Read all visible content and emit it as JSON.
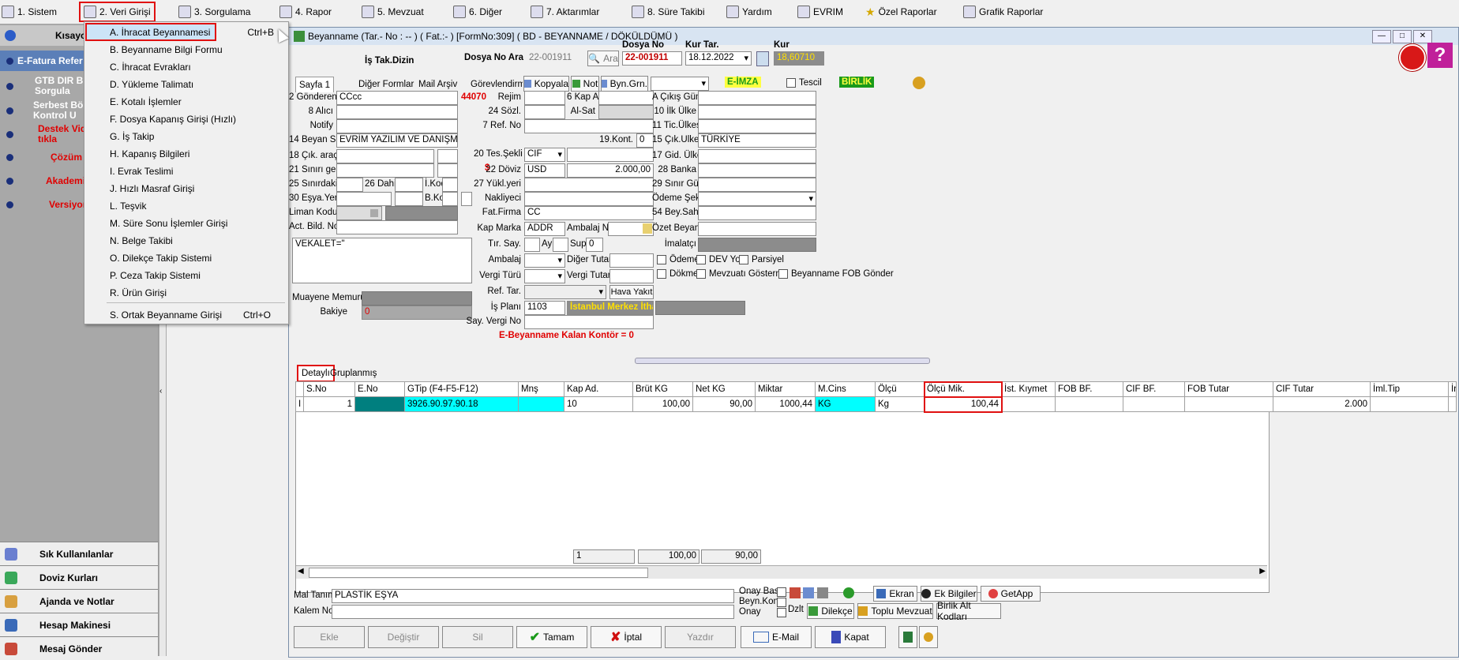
{
  "menubar": {
    "items": [
      {
        "label": "1.  Sistem"
      },
      {
        "label": "2.  Veri Girişi"
      },
      {
        "label": "3.  Sorgulama"
      },
      {
        "label": "4.  Rapor"
      },
      {
        "label": "5.  Mevzuat"
      },
      {
        "label": "6.  Diğer"
      },
      {
        "label": "7.  Aktarımlar"
      },
      {
        "label": "8. Süre Takibi"
      },
      {
        "label": "Yardım"
      },
      {
        "label": "EVRIM"
      },
      {
        "label": "Özel Raporlar"
      },
      {
        "label": "Grafik Raporlar"
      }
    ]
  },
  "sidebar": {
    "header": "Kısayo",
    "rows": [
      {
        "label": "E-Fatura Refer",
        "color": "#ffffff"
      },
      {
        "label": "GTB DIR B Sorgula",
        "color": "#ffffff"
      },
      {
        "label": "Serbest Böl Kontrol U",
        "color": "#ffffff"
      },
      {
        "label": "Destek Vid tıkla",
        "color": "#e00000"
      },
      {
        "label": "Çözüm",
        "color": "#e00000"
      },
      {
        "label": "Akademi",
        "color": "#e00000"
      },
      {
        "label": "Versiyon",
        "color": "#e00000"
      }
    ],
    "bottom": [
      {
        "label": "Sık Kullanılanlar"
      },
      {
        "label": "Doviz Kurları"
      },
      {
        "label": "Ajanda ve Notlar"
      },
      {
        "label": "Hesap Makinesi"
      },
      {
        "label": "Mesaj Gönder"
      }
    ]
  },
  "dropdown": {
    "items": [
      {
        "label": "A.  İhracat Beyannamesi",
        "shortcut": "Ctrl+B"
      },
      {
        "label": "B.  Beyanname Bilgi Formu",
        "shortcut": ""
      },
      {
        "label": "C.  İhracat Evrakları",
        "shortcut": ""
      },
      {
        "label": "D.  Yükleme Talimatı",
        "shortcut": ""
      },
      {
        "label": "E.  Kotalı İşlemler",
        "shortcut": ""
      },
      {
        "label": "F.  Dosya Kapanış Girişi (Hızlı)",
        "shortcut": ""
      },
      {
        "label": "G.  İş Takip",
        "shortcut": ""
      },
      {
        "label": "H.  Kapanış Bilgileri",
        "shortcut": ""
      },
      {
        "label": "I.  Evrak Teslimi",
        "shortcut": ""
      },
      {
        "label": "J.  Hızlı Masraf Girişi",
        "shortcut": ""
      },
      {
        "label": "L.  Teşvik",
        "shortcut": ""
      },
      {
        "label": "M.  Süre Sonu İşlemler Girişi",
        "shortcut": ""
      },
      {
        "label": "N.  Belge Takibi",
        "shortcut": ""
      },
      {
        "label": "O.  Dilekçe Takip Sistemi",
        "shortcut": ""
      },
      {
        "label": "P.  Ceza Takip Sistemi",
        "shortcut": ""
      },
      {
        "label": "R.  Ürün Girişi",
        "shortcut": ""
      },
      {
        "label": "S.  Ortak Beyanname Girişi",
        "shortcut": "Ctrl+O"
      }
    ]
  },
  "window": {
    "title": "Beyanname (Tar.- No :  -- ) ( Fat.:- )  [FormNo:309] ( BD - BEYANNAME / DÖKÜLDÜMÜ )",
    "is_tak_dizin": "İş Tak.Dizin",
    "dosya_no_ara_label": "Dosya No Ara",
    "dosya_no_ara_value": "22-001911",
    "ara_button": "Ara",
    "dosya_no_label": "Dosya No",
    "dosya_no_value": "22-001911",
    "kur_tar_label": "Kur Tar.",
    "kur_tar_value": "18.12.2022",
    "kur_label": "Kur",
    "kur_value": "18,60710"
  },
  "tabs": [
    "Sayfa 1",
    "Diğer Formlar",
    "Mail Arşiv",
    "Görevlendirme"
  ],
  "toolbar": {
    "kopyala": "Kopyala",
    "not": "Not",
    "byn_grn": "Byn.Grn.",
    "e_imza": "E-İMZA",
    "tescil": "Tescil",
    "birlik": "BİRLİK"
  },
  "form": {
    "gonderen_label": "2 Gönderen",
    "gonderen": "CCcc",
    "code_44070": "44070",
    "alici_label": "8 Alıcı",
    "notify_label": "Notify",
    "beyan_label": "14 Beyan S.",
    "beyan": "EVRİM YAZILIM VE DANIŞMANLIK",
    "cik_arac_label": "18 Çık. araç",
    "sinir_gec_label": "21 Sınırı geç.",
    "sinirdaki_label": "25 Sınırdaki",
    "dahili_label": "26 Dahili",
    "ikod_label": "İ.Kod",
    "esya_yeri_label": "30 Eşya.Yeri",
    "bkod_label": "B.Kod",
    "liman_label": "Liman Kodu",
    "act_bild_label": "Act. Bild. No",
    "vekalet": "VEKALET=\"",
    "muayene_label": "Muayene Memuru",
    "bakiye_label": "Bakiye",
    "bakiye": "0",
    "rejim_label": "Rejim",
    "kap_a_label": "6 Kap A.",
    "sozl_label": "24 Sözl.",
    "alsat_label": "Al-Sat",
    "ref_no_label": "7 Ref. No",
    "kont_label": "19.Kont.",
    "kont": "0",
    "tes_sekli_label": "20 Tes.Şekli",
    "tes_sekli": "CIF",
    "doviz_label": "22 Döviz",
    "doviz": "USD",
    "doviz_tutar": "2.000,00",
    "yukl_yeri_label": "27 Yükl.yeri",
    "nakliyeci_label": "Nakliyeci",
    "fat_firma_label": "Fat.Firma",
    "fat_firma": "CC",
    "kap_marka_label": "Kap Marka",
    "kap_marka": "ADDR",
    "ambalaj_no_label": "Ambalaj No",
    "tir_say_label": "Tır. Say.",
    "ay_label": "Ay",
    "sup_label": "Sup",
    "sup": "0",
    "ambalaj_label": "Ambalaj",
    "diger_tutar_label": "Diğer Tutar",
    "vergi_turu_label": "Vergi Türü",
    "vergi_tutar_label": "Vergi Tutar",
    "ref_tar_label": "Ref. Tar.",
    "hava_yakit": "Hava Yakıt",
    "is_plani_label": "İş Planı",
    "is_plani": "1103",
    "is_plani_name": "İstanbul Merkez İthala",
    "say_vergi_label": "Say. Vergi No",
    "kalan_kontor": "E-Beyanname Kalan Kontör = 0",
    "cikis_gum_label": "A Çıkış Güm.",
    "ilk_ulke_label": "10 İlk Ülke",
    "tic_ulke_label": "11 Tic.Ülkesi",
    "cik_ulke_label": "15 Çık.Ulkesi",
    "cik_ulke": "TÜRKİYE",
    "gid_ulke_label": "17 Gid. Ülke",
    "banka_label": "28 Banka",
    "sinir_gum_label": "29 Sınır Güm.",
    "odeme_sekli_label": "Ödeme Şekli",
    "bey_sah_label": "54 Bey.Sah.",
    "ozet_beyan_label": "Özet Beyan",
    "imalatci_label": "İmalatçı",
    "cb_odeme": "Ödeme",
    "cb_dev_yok": "DEV Yok",
    "cb_parsiyel": "Parsiyel",
    "cb_dokme": "Dökme",
    "cb_mevzuat": "Mevzuatı Gösterme",
    "cb_fob": "Beyanname FOB Gönder"
  },
  "grid_tabs": [
    "Detaylı",
    "Gruplanmış"
  ],
  "grid": {
    "columns": [
      "S.No",
      "E.No",
      "GTip (F4-F5-F12)",
      "Mnş",
      "Kap Ad.",
      "Brüt KG",
      "Net KG",
      "Miktar",
      "M.Cins",
      "Ölçü",
      "Ölçü Mik.",
      "İst. Kıymet",
      "FOB BF.",
      "CIF BF.",
      "FOB Tutar",
      "CIF Tutar",
      "İml.Tip",
      "İr"
    ],
    "row": {
      "marker": "I",
      "sno": "1",
      "eno": "",
      "gtip": "3926.90.97.90.18",
      "mns": "",
      "kap_ad": "10",
      "brut": "100,00",
      "net": "90,00",
      "miktar": "1000,44",
      "mcins": "KG",
      "olcu": "Kg",
      "olcu_mik": "100,44",
      "ist": "",
      "fobbf": "",
      "cifbf": "",
      "fob_tutar": "",
      "cif_tutar": "2.000",
      "iml": ""
    },
    "totals": {
      "kap": "1",
      "brut": "100,00",
      "net": "90,00"
    }
  },
  "bottom": {
    "mal_tanimi_label": "Mal Tanımı",
    "mal_tanimi": "PLASTİK EŞYA",
    "kalem_not_label": "Kalem Not",
    "onay_bas": "Onay Bas.",
    "beyn_kont": "Beyn.Kont.",
    "onay": "Onay",
    "ekran": "Ekran",
    "ek_bilgiler": "Ek Bilgiler",
    "getapp": "GetApp",
    "dzlt": "Dzlt",
    "dilekce": "Dilekçe",
    "toplu_mevzuat": "Toplu Mevzuat",
    "birlik_alt": "Birlik Alt Kodları"
  },
  "actions": {
    "ekle": "Ekle",
    "degistir": "Değiştir",
    "sil": "Sil",
    "tamam": "Tamam",
    "iptal": "İptal",
    "yazdir": "Yazdır",
    "email": "E-Mail",
    "kapat": "Kapat"
  }
}
